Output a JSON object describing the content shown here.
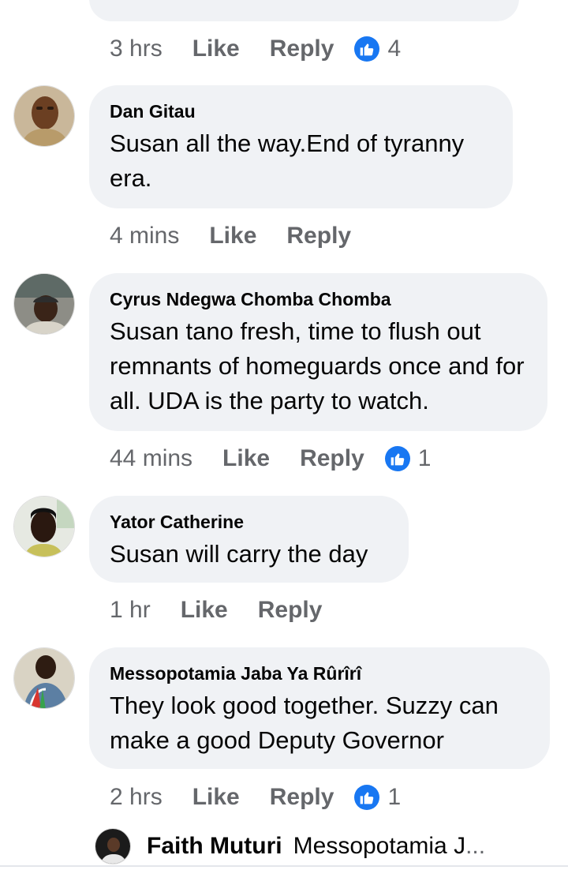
{
  "previous_comment": {
    "time": "3 hrs",
    "like_label": "Like",
    "reply_label": "Reply",
    "reaction_count": "4"
  },
  "comments": [
    {
      "author": "Dan Gitau",
      "text": "Susan all the way.End of tyranny era.",
      "time": "4 mins",
      "like_label": "Like",
      "reply_label": "Reply"
    },
    {
      "author": "Cyrus Ndegwa Chomba Chomba",
      "text": "Susan tano fresh, time to flush out remnants of homeguards once and for all. UDA is the party to watch.",
      "time": "44 mins",
      "like_label": "Like",
      "reply_label": "Reply",
      "reaction_count": "1"
    },
    {
      "author": "Yator Catherine",
      "text": "Susan will carry the day",
      "time": "1 hr",
      "like_label": "Like",
      "reply_label": "Reply"
    },
    {
      "author": "Messopotamia Jaba Ya Rûrîrî",
      "text": "They look good together. Suzzy can make a good Deputy Governor",
      "time": "2 hrs",
      "like_label": "Like",
      "reply_label": "Reply",
      "reaction_count": "1"
    }
  ],
  "reply_preview": {
    "author": "Faith Muturi",
    "text": "Messopotamia J",
    "ellipsis": "..."
  },
  "colors": {
    "bubble_bg": "#f0f2f5",
    "meta_text": "#65676b",
    "like_blue": "#1877f2"
  },
  "icons": {
    "reaction": "thumbs-up-icon"
  }
}
